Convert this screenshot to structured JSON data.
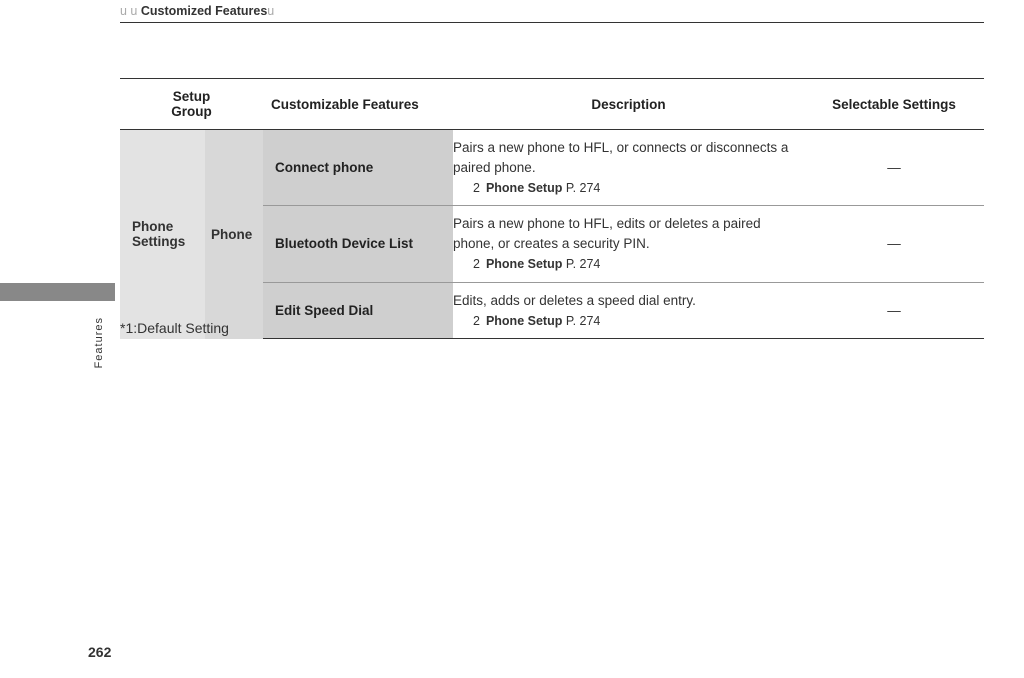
{
  "header": {
    "prefix": "u u ",
    "title": "Customized Features",
    "suffix": "u"
  },
  "sideLabel": "Features",
  "pageNumber": "262",
  "footnote": "*1:Default Setting",
  "columns": {
    "setup": "Setup\nGroup",
    "features": "Customizable Features",
    "description": "Description",
    "selectable": "Selectable Settings"
  },
  "group": {
    "name": "Phone Settings",
    "subgroup": "Phone"
  },
  "rows": [
    {
      "feature": "Connect phone",
      "description": "Pairs a new phone to HFL, or connects or disconnects a paired phone.",
      "refLabel": "Phone Setup",
      "refPage": "P. 274",
      "selectable": "—"
    },
    {
      "feature": "Bluetooth Device List",
      "description": "Pairs a new phone to HFL, edits or deletes a paired phone, or creates a security PIN.",
      "refLabel": "Phone Setup",
      "refPage": "P. 274",
      "selectable": "—"
    },
    {
      "feature": "Edit Speed Dial",
      "description": "Edits, adds or deletes a speed dial entry.",
      "refLabel": "Phone Setup",
      "refPage": "P. 274",
      "selectable": "—"
    }
  ],
  "refMarker": "2"
}
